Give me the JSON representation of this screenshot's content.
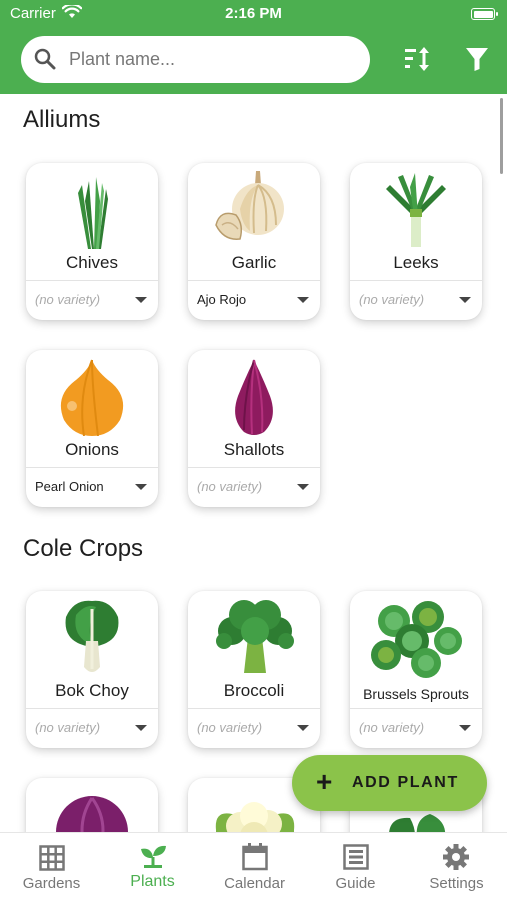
{
  "status_bar": {
    "carrier": "Carrier",
    "time": "2:16 PM"
  },
  "search": {
    "placeholder": "Plant name..."
  },
  "toolbar": {
    "sort_icon": "sort-icon",
    "filter_icon": "filter-icon"
  },
  "colors": {
    "primary": "#4caf50",
    "fab": "#8bc34a",
    "inactive": "#777777"
  },
  "sections": [
    {
      "title": "Alliums",
      "plants": [
        {
          "name": "Chives",
          "variety": "(no variety)",
          "icon": "chives"
        },
        {
          "name": "Garlic",
          "variety": "Ajo Rojo",
          "icon": "garlic"
        },
        {
          "name": "Leeks",
          "variety": "(no variety)",
          "icon": "leeks"
        },
        {
          "name": "Onions",
          "variety": "Pearl Onion",
          "icon": "onion"
        },
        {
          "name": "Shallots",
          "variety": "(no variety)",
          "icon": "shallot"
        }
      ]
    },
    {
      "title": "Cole Crops",
      "plants": [
        {
          "name": "Bok Choy",
          "variety": "(no variety)",
          "icon": "bok-choy"
        },
        {
          "name": "Broccoli",
          "variety": "(no variety)",
          "icon": "broccoli"
        },
        {
          "name": "Brussels Sprouts",
          "variety": "(no variety)",
          "icon": "brussels-sprouts"
        }
      ]
    }
  ],
  "fab": {
    "label": "ADD PLANT"
  },
  "nav": {
    "gardens": "Gardens",
    "plants": "Plants",
    "calendar": "Calendar",
    "guide": "Guide",
    "settings": "Settings"
  }
}
